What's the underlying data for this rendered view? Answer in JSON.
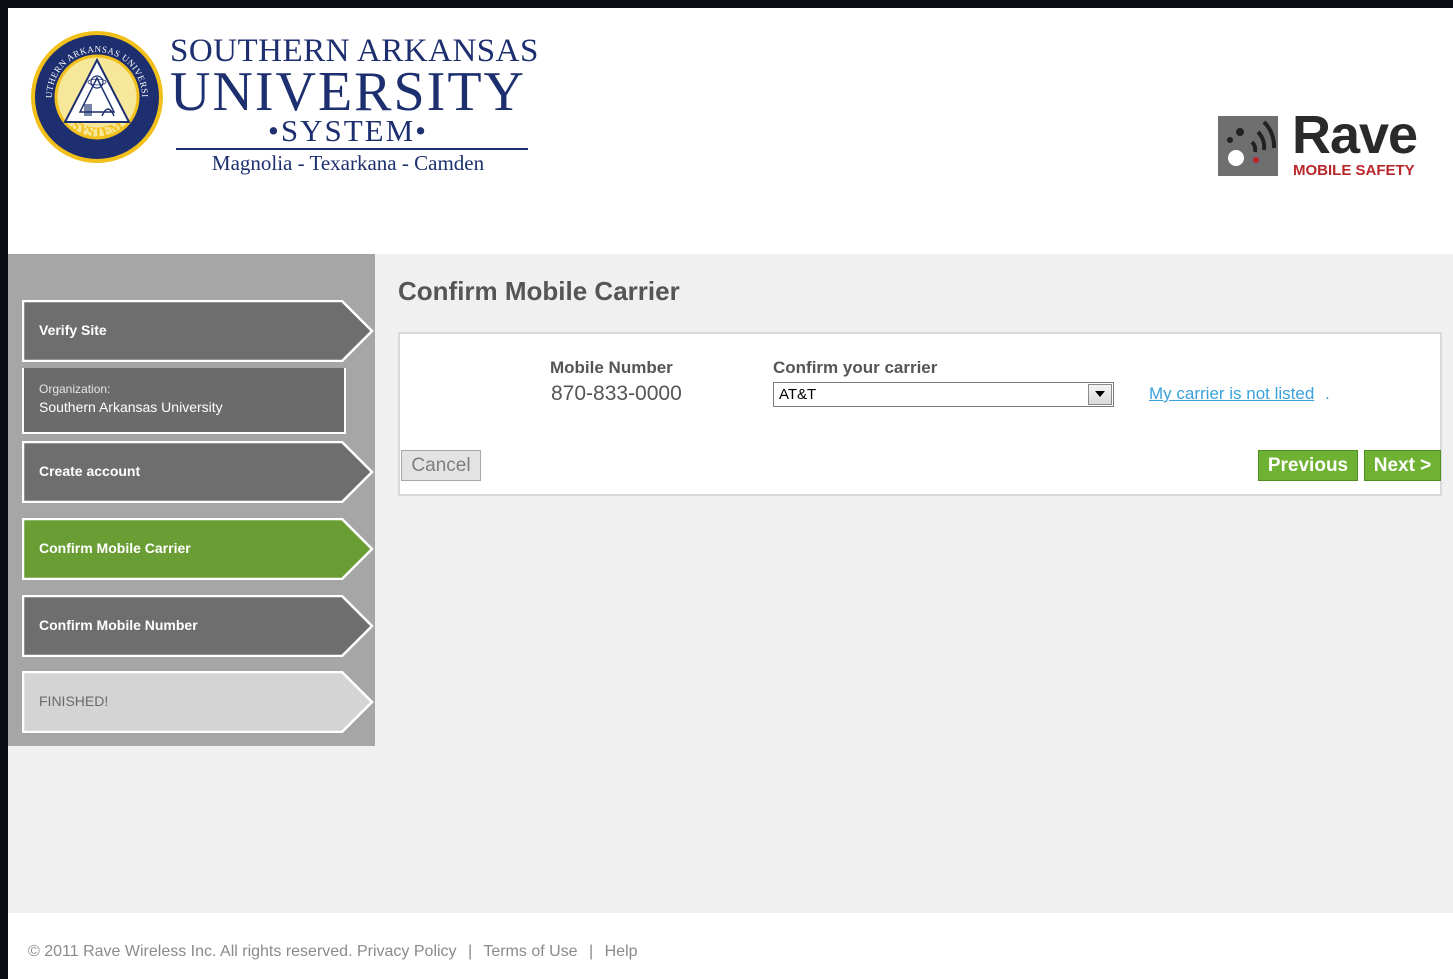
{
  "header": {
    "sau_logo": {
      "seal_text_top": "SOUTHERN ARKANSAS UNIVERSITY",
      "seal_text_bottom": "SYSTEM",
      "line1": "SOUTHERN ARKANSAS",
      "line2": "UNIVERSITY",
      "line3": "•SYSTEM•",
      "line4": "Magnolia  -  Texarkana  -  Camden",
      "navy": "#1d2f6f",
      "gold": "#f2c01a"
    },
    "rave_logo": {
      "name": "Rave",
      "subtitle": "MOBILE SAFETY",
      "accent": "#b8262a"
    }
  },
  "sidebar": {
    "steps": [
      {
        "label": "Verify Site",
        "state": "done"
      },
      {
        "label": "Create account",
        "state": "done"
      },
      {
        "label": "Confirm Mobile Carrier",
        "state": "active"
      },
      {
        "label": "Confirm Mobile Number",
        "state": "pending"
      },
      {
        "label": "FINISHED!",
        "state": "disabled"
      }
    ],
    "organization": {
      "caption": "Organization:",
      "name": "Southern Arkansas University"
    },
    "colors": {
      "done": "#6e6e6e",
      "active": "#6a9e34",
      "disabled": "#d4d4d4"
    }
  },
  "main": {
    "title": "Confirm Mobile Carrier",
    "mobile_number_label": "Mobile Number",
    "mobile_number_value": "870-833-0000",
    "carrier_label": "Confirm your carrier",
    "carrier_selected": "AT&T",
    "carrier_not_listed_link": "My carrier is not listed",
    "cancel_label": "Cancel",
    "previous_label": "Previous",
    "next_label": "Next >",
    "button_green": "#6fb233"
  },
  "footer": {
    "copyright": "© 2011 Rave Wireless Inc. All rights reserved.",
    "privacy": "Privacy Policy",
    "terms": "Terms of Use",
    "help": "Help"
  }
}
